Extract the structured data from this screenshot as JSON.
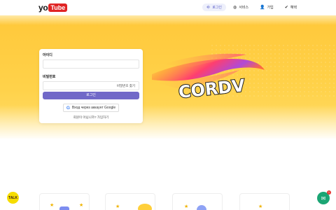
{
  "header": {
    "logo_text": "yo",
    "logo_badge": "Tube",
    "nav": [
      {
        "label": "로그인",
        "icon": "login-icon",
        "active": true
      },
      {
        "label": "서비스",
        "icon": "globe-icon"
      },
      {
        "label": "가입",
        "icon": "user-add-icon"
      },
      {
        "label": "혜택",
        "icon": "check-badge-icon"
      }
    ]
  },
  "hero": {
    "brand_text": "CORDV"
  },
  "login": {
    "id_label": "아이디",
    "password_label": "비밀번호",
    "forgot_label": "비밀번호 찾기",
    "login_button": "로그인",
    "google_button": "Вход через аккаунт Google",
    "google_icon_glyph": "G",
    "signup_text": "회원이 아닙니까? 가입하기"
  },
  "floating": {
    "kakao_label": "TALK",
    "chat_badge": "1"
  },
  "colors": {
    "accent": "#7169c8",
    "hero_yellow": "#ffd24a",
    "logo_red": "#e02424",
    "kakao": "#f6dd00",
    "chat": "#1ba574"
  }
}
